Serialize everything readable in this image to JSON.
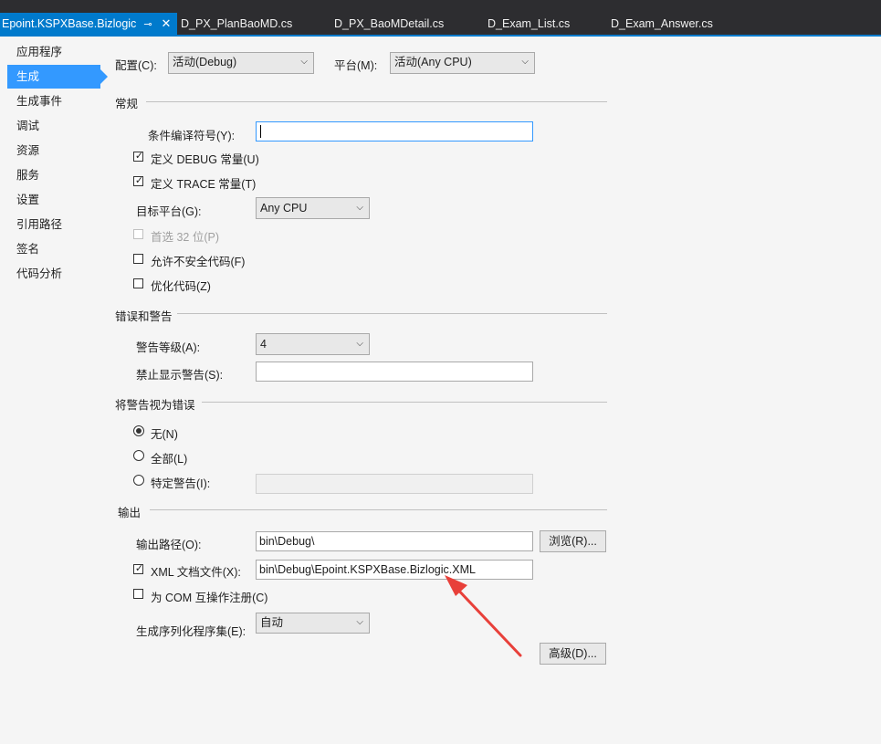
{
  "tabs": [
    {
      "label": "Epoint.KSPXBase.Bizlogic",
      "active": true
    },
    {
      "label": "D_PX_PlanBaoMD.cs"
    },
    {
      "label": "D_PX_BaoMDetail.cs"
    },
    {
      "label": "D_Exam_List.cs"
    },
    {
      "label": "D_Exam_Answer.cs"
    }
  ],
  "active_tab_pin_icon": "pin-icon",
  "active_tab_close_icon": "close-icon",
  "nav": [
    "应用程序",
    "生成",
    "生成事件",
    "调试",
    "资源",
    "服务",
    "设置",
    "引用路径",
    "签名",
    "代码分析"
  ],
  "nav_selected": "生成",
  "config": {
    "label": "配置(C):",
    "value": "活动(Debug)"
  },
  "platform": {
    "label": "平台(M):",
    "value": "活动(Any CPU)"
  },
  "general": {
    "header": "常规",
    "cond_symbols_label": "条件编译符号(Y):",
    "cond_symbols_value": "",
    "define_debug": {
      "label": "定义 DEBUG 常量(U)",
      "checked": true
    },
    "define_trace": {
      "label": "定义 TRACE 常量(T)",
      "checked": true
    },
    "target_platform_label": "目标平台(G):",
    "target_platform_value": "Any CPU",
    "prefer32": {
      "label": "首选 32 位(P)",
      "checked": false,
      "disabled": true
    },
    "unsafe": {
      "label": "允许不安全代码(F)",
      "checked": false
    },
    "optimize": {
      "label": "优化代码(Z)",
      "checked": false
    }
  },
  "errors": {
    "header": "错误和警告",
    "warning_level_label": "警告等级(A):",
    "warning_level_value": "4",
    "suppress_label": "禁止显示警告(S):",
    "suppress_value": ""
  },
  "treat": {
    "header": "将警告视为错误",
    "none": {
      "label": "无(N)",
      "selected": true
    },
    "all": {
      "label": "全部(L)",
      "selected": false
    },
    "specific": {
      "label": "特定警告(I):",
      "selected": false
    },
    "specific_value": ""
  },
  "output": {
    "header": "输出",
    "path_label": "输出路径(O):",
    "path_value": "bin\\Debug\\",
    "browse_label": "浏览(R)...",
    "xml": {
      "label": "XML 文档文件(X):",
      "checked": true
    },
    "xml_value": "bin\\Debug\\Epoint.KSPXBase.Bizlogic.XML",
    "com": {
      "label": "为 COM 互操作注册(C)",
      "checked": false
    },
    "serialization_label": "生成序列化程序集(E):",
    "serialization_value": "自动",
    "advanced_label": "高级(D)..."
  },
  "colors": {
    "accent": "#007acc",
    "selection": "#3399ff",
    "annotation_arrow": "#e8403a"
  }
}
